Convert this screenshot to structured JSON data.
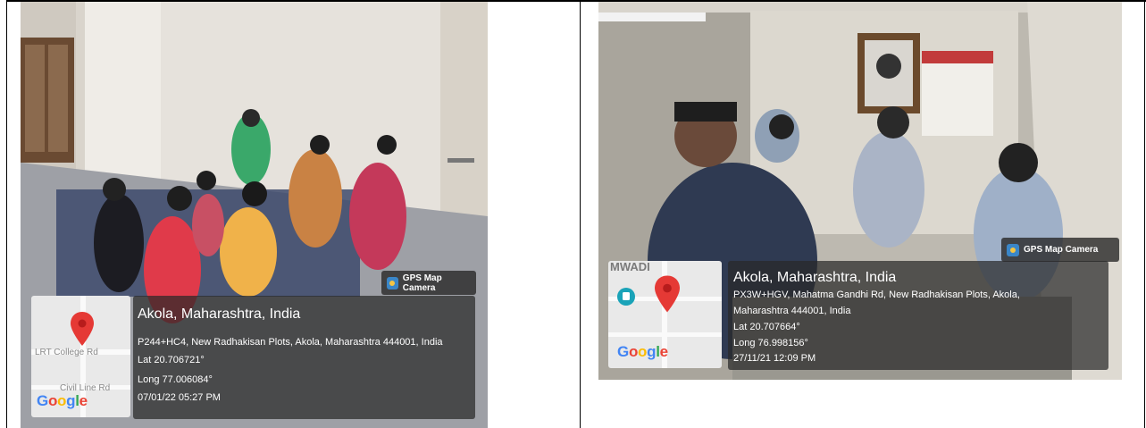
{
  "left_photo": {
    "badge": "GPS Map Camera",
    "location_title": "Akola, Maharashtra, India",
    "address": "P244+HC4, New Radhakisan Plots, Akola, Maharashtra 444001, India",
    "lat": "Lat 20.706721°",
    "long": "Long 77.006084°",
    "datetime": "07/01/22 05:27 PM",
    "map_labels": [
      "LRT College Rd",
      "Civil Line Rd"
    ],
    "map_brand": "Google"
  },
  "right_photo": {
    "badge": "GPS Map Camera",
    "location_title": "Akola, Maharashtra, India",
    "address_line1": "PX3W+HGV, Mahatma Gandhi Rd, New Radhakisan Plots, Akola,",
    "address_line2": "Maharashtra 444001, India",
    "lat": "Lat 20.707664°",
    "long": "Long 76.998156°",
    "datetime": "27/11/21 12:09 PM",
    "map_labels": [
      "MWADI"
    ],
    "map_brand": "Google"
  },
  "colors": {
    "pin": "#e53935",
    "overlay": "#2b2b2b",
    "google_blue": "#4285F4",
    "google_red": "#EA4335",
    "google_yellow": "#FBBC05",
    "google_green": "#34A853"
  }
}
